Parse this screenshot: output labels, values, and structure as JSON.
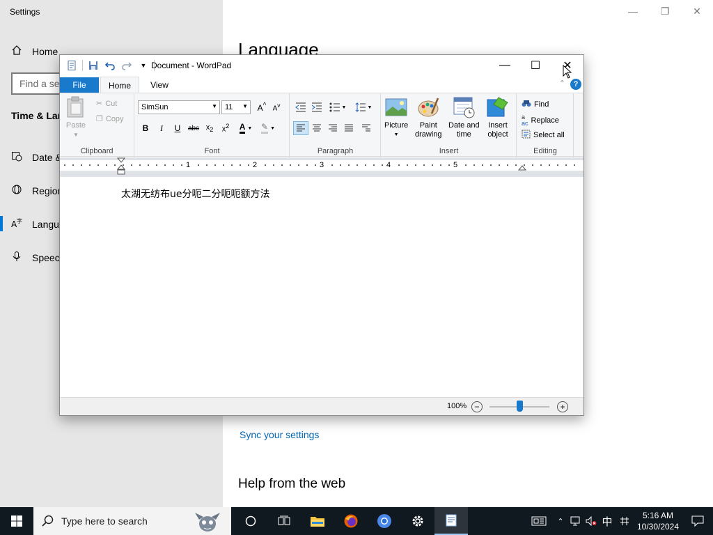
{
  "settings": {
    "title": "Settings",
    "home_label": "Home",
    "search_placeholder": "Find a setting",
    "section": "Time & Language",
    "nav": [
      {
        "label": "Date & time"
      },
      {
        "label": "Region"
      },
      {
        "label": "Language"
      },
      {
        "label": "Speech"
      }
    ],
    "heading": "Language",
    "sync_link": "Sync your settings",
    "help_heading": "Help from the web"
  },
  "wordpad": {
    "title": "Document - WordPad",
    "tabs": {
      "file": "File",
      "home": "Home",
      "view": "View"
    },
    "clipboard": {
      "paste": "Paste",
      "cut": "Cut",
      "copy": "Copy",
      "group": "Clipboard"
    },
    "font": {
      "family": "SimSun",
      "size": "11",
      "group": "Font"
    },
    "paragraph": {
      "group": "Paragraph"
    },
    "insert": {
      "picture": "Picture",
      "paint_drawing_1": "Paint",
      "paint_drawing_2": "drawing",
      "date_time_1": "Date and",
      "date_time_2": "time",
      "insert_object_1": "Insert",
      "insert_object_2": "object",
      "group": "Insert"
    },
    "editing": {
      "find": "Find",
      "replace": "Replace",
      "select_all": "Select all",
      "group": "Editing"
    },
    "ruler_numbers": [
      "1",
      "2",
      "3",
      "4",
      "5"
    ],
    "document_text": "太湖无纺布ue分呃二分呃呃额方法",
    "zoom": "100%",
    "zoom_fraction": 0.5
  },
  "taskbar": {
    "search_placeholder": "Type here to search",
    "time": "5:16 AM",
    "date": "10/30/2024",
    "ime": "中"
  },
  "colors": {
    "accent": "#1979ca",
    "taskbar": "#101820",
    "link": "#0067b8"
  }
}
